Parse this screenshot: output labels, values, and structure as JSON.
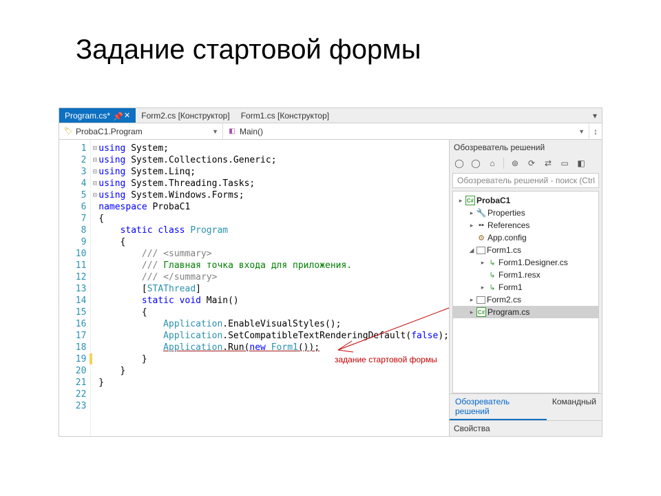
{
  "slide": {
    "title": "Задание стартовой формы"
  },
  "tabs": [
    {
      "label": "Program.cs*",
      "active": true,
      "pinned": true
    },
    {
      "label": "Form2.cs [Конструктор]",
      "active": false
    },
    {
      "label": "Form1.cs [Конструктор]",
      "active": false
    }
  ],
  "nav": {
    "left": "ProbaC1.Program",
    "right": "Main()"
  },
  "code": {
    "lines": [
      {
        "n": 1,
        "fold": "⊟",
        "tokens": [
          [
            "kw",
            "using"
          ],
          [
            "",
            " System;"
          ]
        ]
      },
      {
        "n": 2,
        "tokens": [
          [
            "kw",
            "using"
          ],
          [
            "",
            " System.Collections.Generic;"
          ]
        ]
      },
      {
        "n": 3,
        "tokens": [
          [
            "kw",
            "using"
          ],
          [
            "",
            " System.Linq;"
          ]
        ]
      },
      {
        "n": 4,
        "tokens": [
          [
            "kw",
            "using"
          ],
          [
            "",
            " System.Threading.Tasks;"
          ]
        ]
      },
      {
        "n": 5,
        "tokens": [
          [
            "kw",
            "using"
          ],
          [
            "",
            " System.Windows.Forms;"
          ]
        ]
      },
      {
        "n": 6,
        "tokens": []
      },
      {
        "n": 7,
        "fold": "⊟",
        "tokens": [
          [
            "kw",
            "namespace"
          ],
          [
            "",
            " ProbaC1"
          ]
        ]
      },
      {
        "n": 8,
        "tokens": [
          [
            "",
            "{"
          ]
        ]
      },
      {
        "n": 9,
        "fold": "⊟",
        "tokens": [
          [
            "",
            "    "
          ],
          [
            "kw",
            "static class"
          ],
          [
            "",
            " "
          ],
          [
            "typ",
            "Program"
          ]
        ]
      },
      {
        "n": 10,
        "tokens": [
          [
            "",
            "    {"
          ]
        ]
      },
      {
        "n": 11,
        "fold": "⊟",
        "tokens": [
          [
            "",
            "        "
          ],
          [
            "cmtgrey",
            "/// "
          ],
          [
            "cmtgrey",
            "<summary>"
          ]
        ]
      },
      {
        "n": 12,
        "tokens": [
          [
            "",
            "        "
          ],
          [
            "cmtgrey",
            "/// "
          ],
          [
            "cmt",
            "Главная точка входа для приложения."
          ]
        ]
      },
      {
        "n": 13,
        "tokens": [
          [
            "",
            "        "
          ],
          [
            "cmtgrey",
            "/// "
          ],
          [
            "cmtgrey",
            "</summary>"
          ]
        ]
      },
      {
        "n": 14,
        "tokens": [
          [
            "",
            "        ["
          ],
          [
            "typ",
            "STAThread"
          ],
          [
            "",
            "]"
          ]
        ]
      },
      {
        "n": 15,
        "fold": "⊟",
        "tokens": [
          [
            "",
            "        "
          ],
          [
            "kw",
            "static void"
          ],
          [
            "",
            " Main()"
          ]
        ]
      },
      {
        "n": 16,
        "tokens": [
          [
            "",
            "        {"
          ]
        ]
      },
      {
        "n": 17,
        "tokens": [
          [
            "",
            "            "
          ],
          [
            "typ",
            "Application"
          ],
          [
            "",
            ".EnableVisualStyles();"
          ]
        ]
      },
      {
        "n": 18,
        "tokens": [
          [
            "",
            "            "
          ],
          [
            "typ",
            "Application"
          ],
          [
            "",
            ".SetCompatibleTextRenderingDefault("
          ],
          [
            "kw",
            "false"
          ],
          [
            "",
            ");"
          ]
        ]
      },
      {
        "n": 19,
        "mark": true,
        "tokens": [
          [
            "",
            "            "
          ],
          [
            "typ",
            "Application"
          ],
          [
            "",
            ".Run("
          ],
          [
            "kw",
            "new"
          ],
          [
            "",
            " "
          ],
          [
            "typ",
            "Form1"
          ],
          [
            "",
            "());"
          ]
        ]
      },
      {
        "n": 20,
        "tokens": [
          [
            "",
            "        }"
          ]
        ]
      },
      {
        "n": 21,
        "tokens": [
          [
            "",
            "    }"
          ]
        ]
      },
      {
        "n": 22,
        "tokens": [
          [
            "",
            "}"
          ]
        ]
      },
      {
        "n": 23,
        "tokens": []
      }
    ],
    "underline_line": 19,
    "annotation": "задание стартовой\nформы"
  },
  "solution": {
    "title": "Обозреватель решений",
    "search_placeholder": "Обозреватель решений - поиск (Ctrl",
    "project": "ProbaC1",
    "nodes": [
      {
        "depth": 0,
        "exp": "▸",
        "icon": "cs",
        "label": "ProbaC1",
        "bold": true
      },
      {
        "depth": 1,
        "exp": "▸",
        "icon": "wrench",
        "label": "Properties"
      },
      {
        "depth": 1,
        "exp": "▸",
        "icon": "ref",
        "label": "References"
      },
      {
        "depth": 1,
        "exp": "",
        "icon": "cfg",
        "label": "App.config"
      },
      {
        "depth": 1,
        "exp": "◢",
        "icon": "form",
        "label": "Form1.cs"
      },
      {
        "depth": 2,
        "exp": "▸",
        "icon": "formchild",
        "label": "Form1.Designer.cs"
      },
      {
        "depth": 2,
        "exp": "",
        "icon": "formchild",
        "label": "Form1.resx"
      },
      {
        "depth": 2,
        "exp": "▸",
        "icon": "formchild",
        "label": "Form1"
      },
      {
        "depth": 1,
        "exp": "▸",
        "icon": "form",
        "label": "Form2.cs"
      },
      {
        "depth": 1,
        "exp": "▸",
        "icon": "cs",
        "label": "Program.cs",
        "selected": true
      }
    ],
    "tabs": {
      "active": "Обозреватель решений",
      "other": "Командный"
    },
    "props_title": "Свойства"
  }
}
